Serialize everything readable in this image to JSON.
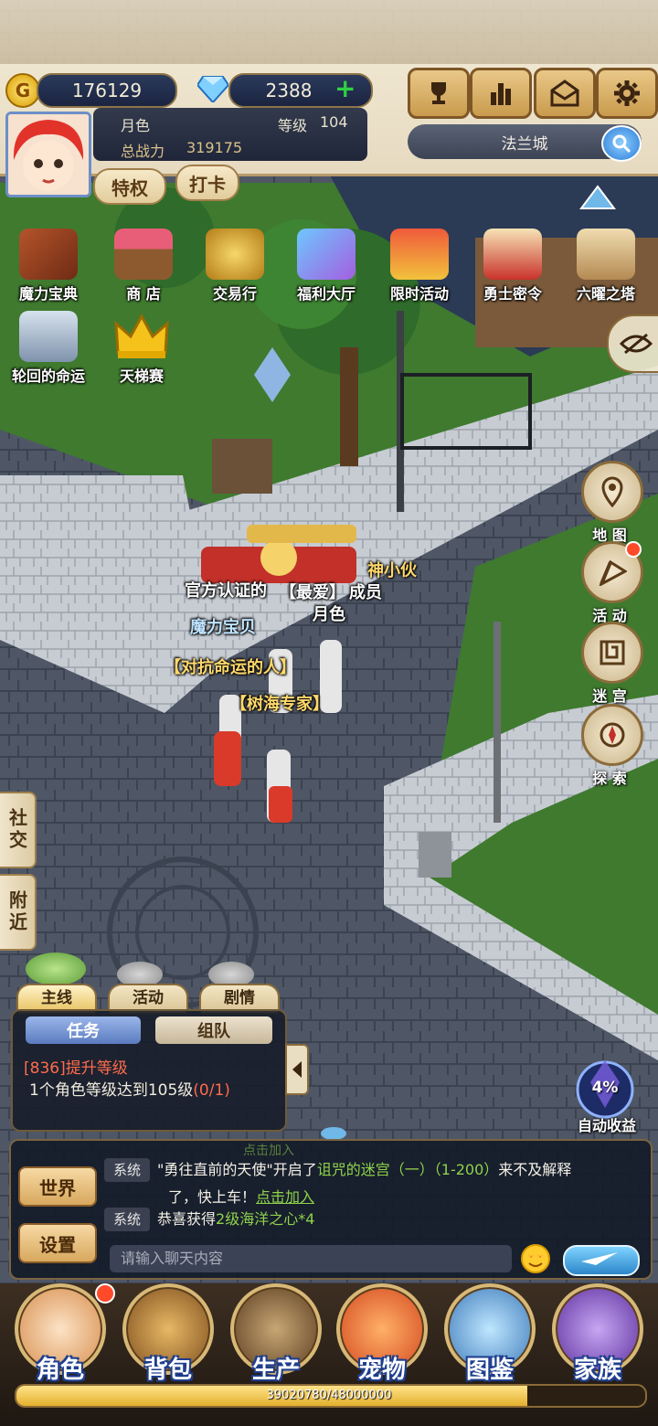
{
  "top_hud": {
    "gold": "176129",
    "gems": "2388",
    "player_name": "月色",
    "level_label": "等级",
    "level_value": "104",
    "power_label": "总战力",
    "power_value": "319175",
    "privilege_button": "特权",
    "checkin_button": "打卡",
    "location": "法兰城"
  },
  "feature_icons_row1": [
    "魔力宝典",
    "商 店",
    "交易行",
    "福利大厅",
    "限时活动",
    "勇士密令",
    "六曜之塔"
  ],
  "feature_icons_row2": [
    "轮回的命运",
    "天梯赛"
  ],
  "right_menu": [
    "地 图",
    "活 动",
    "迷 宫",
    "探 索"
  ],
  "side_tabs": [
    "社交",
    "附近"
  ],
  "world_labels": {
    "npc_left": "官方认证的",
    "npc_fav": "【最爱】",
    "npc_member": "成员",
    "npc_right": "神小伙",
    "player": "月色",
    "title1": "魔力宝贝",
    "title2": "【对抗命运的人】",
    "title3": "【树海专家】"
  },
  "quest": {
    "tabs": [
      "主线",
      "活动",
      "剧情"
    ],
    "subtabs": [
      "任务",
      "组队"
    ],
    "title": "[836]提升等级",
    "desc": "1个角色等级达到105级",
    "progress": "(0/1)"
  },
  "auto_income": {
    "percent": "4%",
    "label": "自动收益"
  },
  "chat": {
    "channel_button": "世界",
    "settings_button": "设置",
    "faded_line": "点击加入",
    "msg1": {
      "tag": "系统",
      "quote": "\"勇往直前的天使\"",
      "opened": "开启了",
      "dungeon": "诅咒的迷宫（一）",
      "range": "（1-200）",
      "tail": "来不及解释",
      "line2": "了，快上车！",
      "join": "点击加入"
    },
    "msg2": {
      "tag": "系统",
      "prefix": "恭喜获得",
      "item": "2级海洋之心*4"
    },
    "input_placeholder": "请输入聊天内容"
  },
  "bottom_nav": [
    "角色",
    "背包",
    "生产",
    "宠物",
    "图鉴",
    "家族"
  ],
  "exp": {
    "text": "39020780/48000000",
    "fraction": 0.813
  },
  "colors": {
    "accent_green": "#8fd34a",
    "quest_red": "#ff6b4d",
    "system_msg_white": "#f5f1e6"
  }
}
